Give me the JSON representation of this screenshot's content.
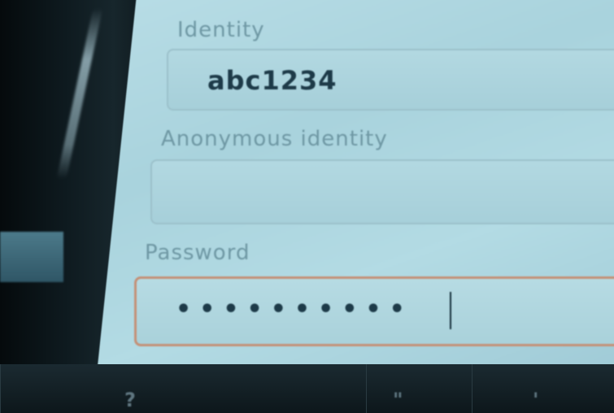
{
  "form": {
    "identity": {
      "label": "Identity",
      "value": "abc1234"
    },
    "anonymous_identity": {
      "label": "Anonymous identity",
      "value": ""
    },
    "password": {
      "label": "Password",
      "masked_value": "••••••••••"
    }
  },
  "keyboard_bar": {
    "keys": [
      "?",
      "\"",
      "'"
    ]
  },
  "colors": {
    "screen_bg": "#b3dbe4",
    "label_text": "#6f98a4",
    "value_text": "#1d3a48",
    "focus_border": "#c49178"
  },
  "icons": {
    "text_cursor": "text-cursor-icon"
  }
}
